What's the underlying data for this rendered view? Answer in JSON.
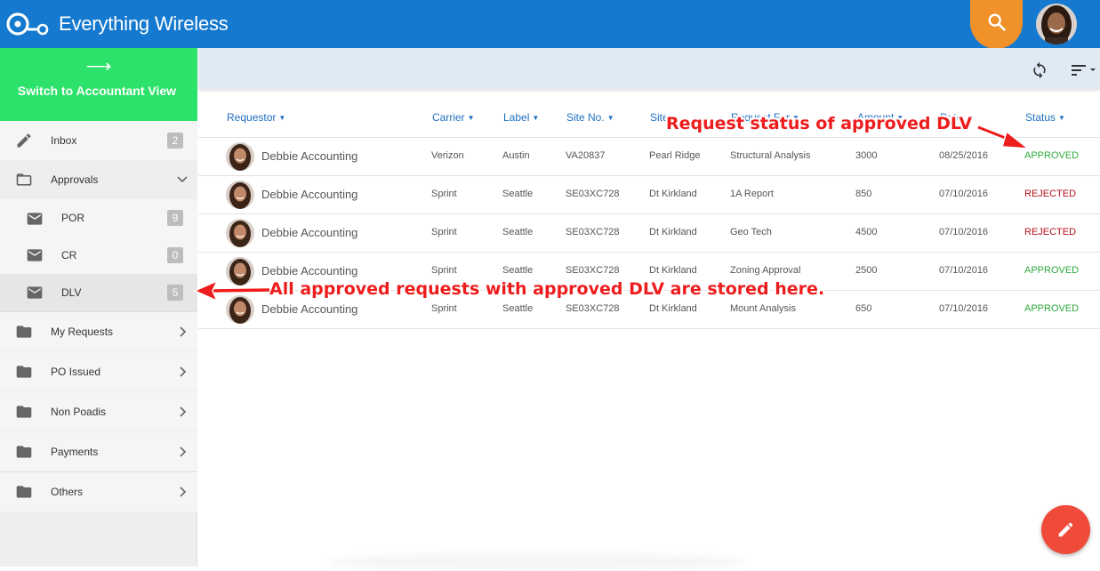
{
  "app": {
    "title": "Everything Wireless"
  },
  "sidebar": {
    "switch_arrow": "⟶",
    "switch_label": "Switch to Accountant View",
    "items": [
      {
        "label": "Inbox",
        "badge": "2",
        "icon": "pencil-icon"
      },
      {
        "label": "Approvals",
        "icon": "folder-outline-icon",
        "expanded": true
      },
      {
        "label": "POR",
        "badge": "9",
        "icon": "mail-icon"
      },
      {
        "label": "CR",
        "badge": "0",
        "icon": "mail-icon"
      },
      {
        "label": "DLV",
        "badge": "5",
        "icon": "mail-icon"
      },
      {
        "label": "My Requests",
        "icon": "folder-icon"
      },
      {
        "label": "PO Issued",
        "icon": "folder-icon"
      },
      {
        "label": "Non Poadis",
        "icon": "folder-icon"
      },
      {
        "label": "Payments",
        "icon": "folder-icon"
      },
      {
        "label": "Others",
        "icon": "folder-icon"
      }
    ]
  },
  "table": {
    "headers": [
      "Requestor",
      "Carrier",
      "Label",
      "Site No.",
      "Site",
      "Request For",
      "Amount",
      "Date",
      "Status"
    ],
    "rows": [
      {
        "requestor": "Debbie Accounting",
        "carrier": "Verizon",
        "label": "Austin",
        "site_no": "VA20837",
        "site": "Pearl Ridge",
        "request_for": "Structural Analysis",
        "amount": "3000",
        "date": "08/25/2016",
        "status": "APPROVED"
      },
      {
        "requestor": "Debbie Accounting",
        "carrier": "Sprint",
        "label": "Seattle",
        "site_no": "SE03XC728",
        "site": "Dt Kirkland",
        "request_for": "1A Report",
        "amount": "850",
        "date": "07/10/2016",
        "status": "REJECTED"
      },
      {
        "requestor": "Debbie Accounting",
        "carrier": "Sprint",
        "label": "Seattle",
        "site_no": "SE03XC728",
        "site": "Dt Kirkland",
        "request_for": "Geo Tech",
        "amount": "4500",
        "date": "07/10/2016",
        "status": "REJECTED"
      },
      {
        "requestor": "Debbie Accounting",
        "carrier": "Sprint",
        "label": "Seattle",
        "site_no": "SE03XC728",
        "site": "Dt Kirkland",
        "request_for": "Zoning Approval",
        "amount": "2500",
        "date": "07/10/2016",
        "status": "APPROVED"
      },
      {
        "requestor": "Debbie Accounting",
        "carrier": "Sprint",
        "label": "Seattle",
        "site_no": "SE03XC728",
        "site": "Dt Kirkland",
        "request_for": "Mount Analysis",
        "amount": "650",
        "date": "07/10/2016",
        "status": "APPROVED"
      }
    ]
  },
  "annotations": {
    "status_note": "Request status of approved DLV",
    "dlv_note": "All approved requests with approved DLV are stored here."
  },
  "colors": {
    "topbar": "#1479cf",
    "switch_button": "#2de26a",
    "search_fab": "#f0912a",
    "edit_fab": "#f04a3a",
    "approved": "#2eaa3c",
    "rejected": "#b5121b",
    "annotation": "#ee1d1d"
  }
}
